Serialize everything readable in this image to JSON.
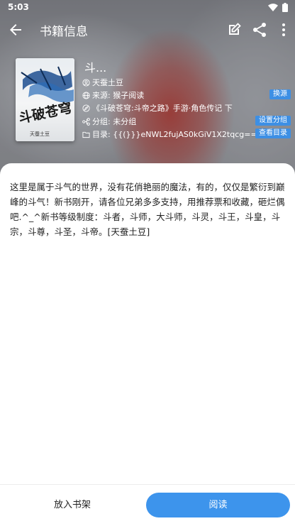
{
  "status_bar": {
    "time": "5:03"
  },
  "toolbar": {
    "title": "书籍信息"
  },
  "book": {
    "name": "斗...",
    "author": "天蚕土豆",
    "source": "来源: 猴子阅读",
    "latest": "《斗破苍穹:斗帝之路》手游·角色传记 下",
    "group": "分组: 未分组",
    "toc": "目录: {{(}}}eNWL2fujAS0kGiV1X2tqcg==",
    "cover_title": "斗破苍穹",
    "cover_author": "天蚕土豆"
  },
  "actions": {
    "change_source": "换源",
    "set_group": "设置分组",
    "view_toc": "查看目录"
  },
  "intro": "这里是属于斗气的世界，没有花俏艳丽的魔法，有的，仅仅是繁衍到巅峰的斗气！新书刚开，请各位兄弟多多支持，用推荐票和收藏，砸烂偶吧.^_^新书等级制度：斗者，斗师，大斗师，斗灵，斗王，斗皇，斗宗，斗尊，斗圣，斗帝。[天蚕土豆]",
  "bottom": {
    "add_shelf": "放入书架",
    "read": "阅读"
  }
}
